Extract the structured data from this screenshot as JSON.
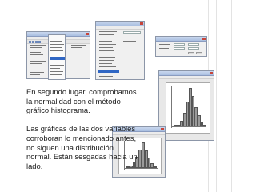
{
  "caption": {
    "paragraph1": "En segundo lugar, comprobamos la normalidad con el método gráfico histograma.",
    "paragraph2": "Las gráficas de las dos variables corroboran lo mencionado antes, no siguen una distribución normal. Están sesgadas hacia un lado."
  },
  "histograms": [
    {
      "bars": [
        0.03,
        0.05,
        0.15,
        0.35,
        0.65,
        1.0,
        0.8,
        0.5,
        0.3,
        0.12,
        0.05
      ],
      "bar_color": "#9a9a9a"
    },
    {
      "bars": [
        0.04,
        0.1,
        0.22,
        0.45,
        0.72,
        1.0,
        0.7,
        0.4,
        0.18,
        0.06
      ],
      "bar_color": "#9a9a9a"
    }
  ],
  "colors": {
    "accent": "#2f66c4",
    "titlebar": "#b8cce8"
  },
  "icons": {
    "close": "close-icon",
    "toolbar": "toolbar-icon"
  }
}
